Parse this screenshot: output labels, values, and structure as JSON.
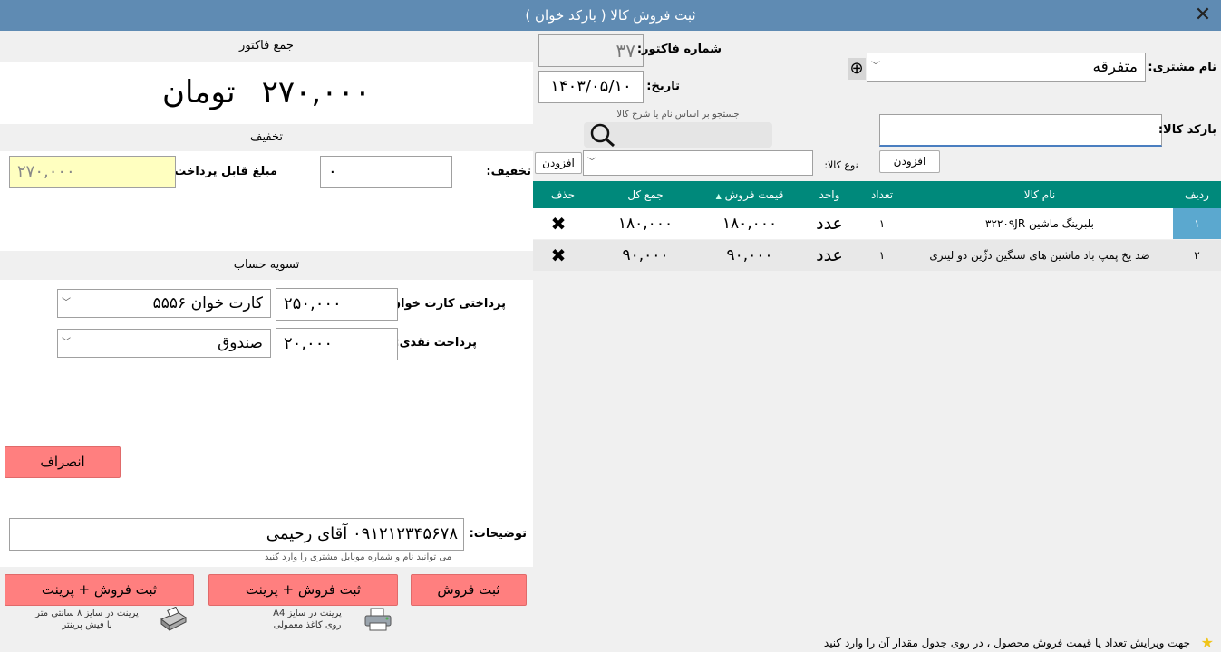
{
  "window": {
    "title": "ثبت فروش کالا ( بارکد خوان )"
  },
  "invoice": {
    "number_label": "شماره فاکتور:",
    "number_value": "۳۷",
    "date_label": "تاریخ:",
    "date_value": "۱۴۰۳/۰۵/۱۰",
    "customer_label": "نام مشتری:",
    "customer_value": "متفرقه"
  },
  "total": {
    "header": "جمع فاکتور",
    "amount": "۲۷۰,۰۰۰",
    "currency": "تومان"
  },
  "discount": {
    "header": "تخفیف",
    "label": "تخفیف:",
    "value": "۰",
    "payable_label": "مبلغ قابل پرداخت:",
    "payable_value": "۲۷۰,۰۰۰"
  },
  "settlement": {
    "header": "تسویه حساب",
    "card_label": "پرداختی کارت خوان:",
    "card_value": "۲۵۰,۰۰۰",
    "card_account": "کارت خوان ۵۵۵۶",
    "cash_label": "پرداخت نقدی:",
    "cash_value": "۲۰,۰۰۰",
    "cash_account": "صندوق"
  },
  "buttons": {
    "cancel": "انصراف",
    "register": "ثبت فروش",
    "register_print_a4": "ثبت فروش + پرینت",
    "register_print_receipt": "ثبت فروش + پرینت",
    "add_barcode": "افزودن",
    "add_type": "افزودن"
  },
  "print_notes": {
    "a4_line1": "پرینت در سایز A4",
    "a4_line2": "روی کاغذ معمولی",
    "receipt_line1": "پرینت در سایز ۸ سانتی متر",
    "receipt_line2": "با فیش پرینتر"
  },
  "notes": {
    "label": "توضیحات:",
    "value": "۰۹۱۲۱۲۳۴۵۶۷۸ آقای رحیمی",
    "hint": "می توانید نام و شماره موبایل مشتری را وارد کنید"
  },
  "search": {
    "barcode_label": "بارکد کالا:",
    "search_hint": "جستجو بر اساس نام یا شرح کالا",
    "type_label": "نوع کالا:"
  },
  "grid": {
    "headers": {
      "row": "ردیف",
      "name": "نام کالا",
      "qty": "تعداد",
      "unit": "واحد",
      "price": "قیمت فروش",
      "total": "جمع کل",
      "delete": "حذف"
    },
    "rows": [
      {
        "row": "۱",
        "name": "بلبرینگ ماشین ۳۲۲۰۹JR",
        "qty": "۱",
        "unit": "عدد",
        "price": "۱۸۰,۰۰۰",
        "total": "۱۸۰,۰۰۰"
      },
      {
        "row": "۲",
        "name": "ضد یخ پمپ باد ماشین های سنگین دژّین دو لیتری",
        "qty": "۱",
        "unit": "عدد",
        "price": "۹۰,۰۰۰",
        "total": "۹۰,۰۰۰"
      }
    ]
  },
  "status": {
    "text": "جهت ویرایش تعداد یا قیمت فروش محصول ، در روی جدول مقدار آن را وارد کنید"
  },
  "colors": {
    "titlebar": "#5f8bb3",
    "grid_header": "#00897b",
    "red_button": "#ff7f7f",
    "payable_bg": "#ffffc0",
    "selected_cell": "#5ba8cf"
  },
  "icons": {
    "close": "close-icon",
    "add_customer": "plus-circle-icon",
    "search": "search-icon",
    "delete": "delete-x-icon",
    "printer": "printer-icon",
    "receipt_printer": "receipt-printer-icon",
    "star": "star-icon",
    "sort": "sort-ascending-icon"
  }
}
